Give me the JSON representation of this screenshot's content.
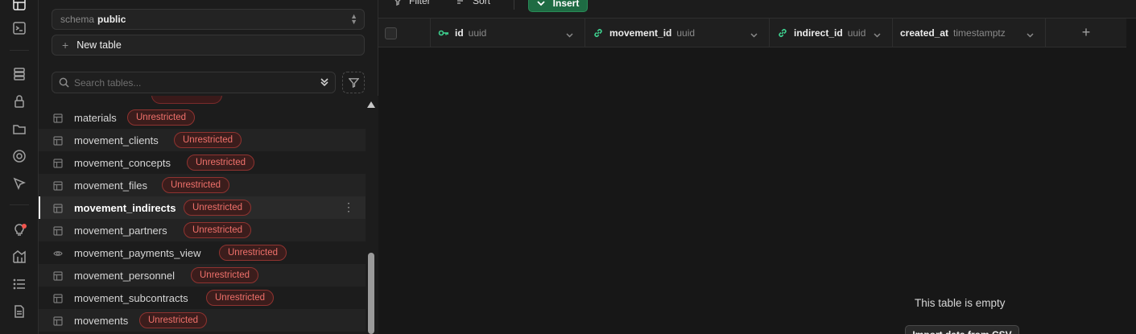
{
  "colors": {
    "accent_green": "#1e6b43",
    "unrestricted_red": "#f0716b",
    "background": "#1c1c1c"
  },
  "rail": {
    "icons": [
      "table-editor-icon",
      "sql-editor-icon",
      "database-icon",
      "auth-lock-icon",
      "storage-folder-icon",
      "realtime-icon",
      "edge-functions-icon",
      "advisor-lightbulb-icon",
      "reports-icon",
      "logs-list-icon",
      "docs-icon"
    ]
  },
  "sidebar": {
    "schema_label": "schema",
    "schema_value": "public",
    "new_table_label": "New table",
    "search_placeholder": "Search tables...",
    "tables": [
      {
        "name": "materials",
        "badge": "Unrestricted",
        "icon": "table-icon"
      },
      {
        "name": "movement_clients",
        "badge": "Unrestricted",
        "icon": "table-icon"
      },
      {
        "name": "movement_concepts",
        "badge": "Unrestricted",
        "icon": "table-icon"
      },
      {
        "name": "movement_files",
        "badge": "Unrestricted",
        "icon": "table-icon"
      },
      {
        "name": "movement_indirects",
        "badge": "Unrestricted",
        "icon": "table-icon",
        "selected": true
      },
      {
        "name": "movement_partners",
        "badge": "Unrestricted",
        "icon": "table-icon"
      },
      {
        "name": "movement_payments_view",
        "badge": "Unrestricted",
        "icon": "eye-icon"
      },
      {
        "name": "movement_personnel",
        "badge": "Unrestricted",
        "icon": "table-icon"
      },
      {
        "name": "movement_subcontracts",
        "badge": "Unrestricted",
        "icon": "table-icon"
      },
      {
        "name": "movements",
        "badge": "Unrestricted",
        "icon": "table-icon"
      }
    ]
  },
  "toolbar": {
    "filter_label": "Filter",
    "sort_label": "Sort",
    "insert_label": "Insert"
  },
  "grid": {
    "columns": [
      {
        "name": "id",
        "type": "uuid",
        "icon": "key-icon"
      },
      {
        "name": "movement_id",
        "type": "uuid",
        "icon": "link-icon"
      },
      {
        "name": "indirect_id",
        "type": "uuid",
        "icon": "link-icon"
      },
      {
        "name": "created_at",
        "type": "timestamptz",
        "icon": ""
      }
    ],
    "add_column_label": "+",
    "empty_title": "This table is empty",
    "import_label": "Import data from CSV"
  }
}
